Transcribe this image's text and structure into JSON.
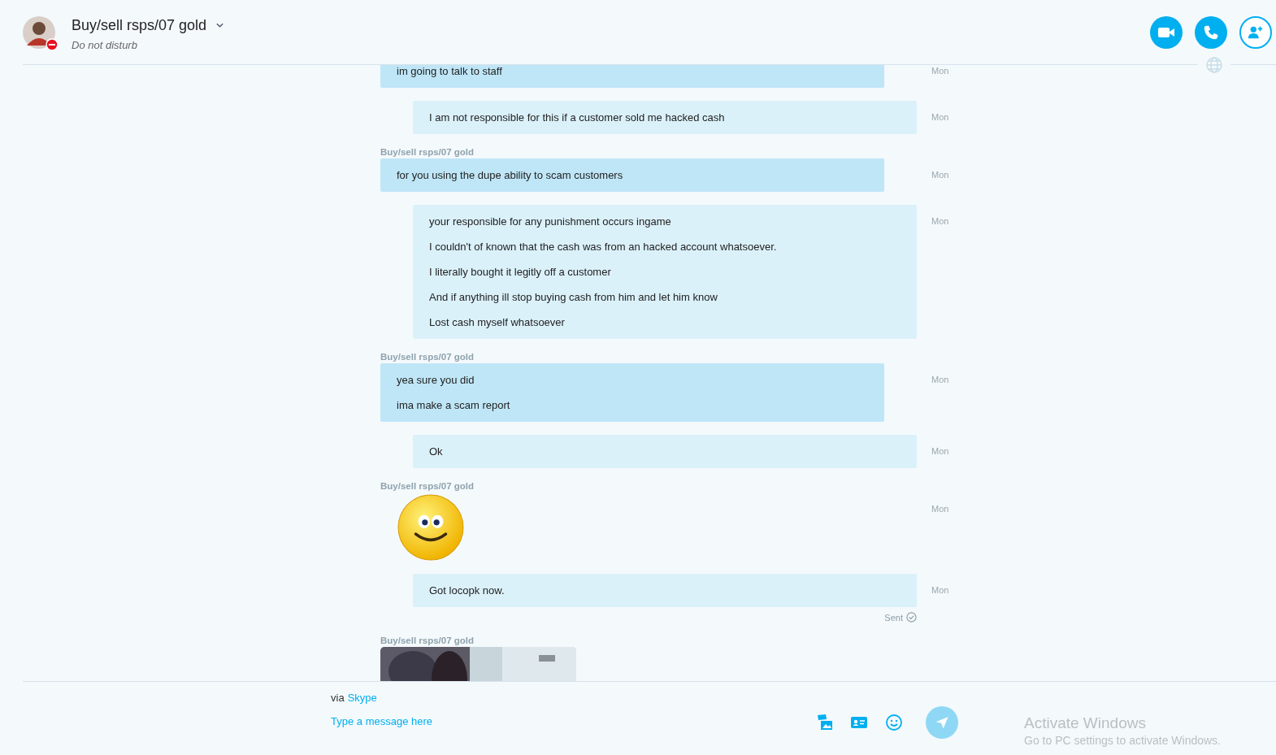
{
  "header": {
    "title": "Buy/sell rsps/07 gold",
    "status": "Do not disturb",
    "do_not_disturb": true
  },
  "messages": [
    {
      "kind": "incoming",
      "lines": [
        "im going to talk to staff"
      ],
      "time": "Mon"
    },
    {
      "kind": "outgoing",
      "lines": [
        "I am not responsible for this if a customer sold me hacked cash"
      ],
      "time": "Mon"
    },
    {
      "kind": "incoming",
      "sender": "Buy/sell rsps/07 gold",
      "lines": [
        "for you using the dupe ability to scam customers"
      ],
      "time": "Mon"
    },
    {
      "kind": "outgoing",
      "lines": [
        "your responsible for any punishment occurs ingame",
        "I couldn't of known that the cash was from an hacked account whatsoever.",
        "I literally bought it legitly off a customer",
        "And if anything ill stop buying cash from him and let him know",
        "Lost cash myself whatsoever"
      ],
      "time": "Mon"
    },
    {
      "kind": "incoming",
      "sender": "Buy/sell rsps/07 gold",
      "lines": [
        "yea sure you did",
        "ima make a scam report"
      ],
      "time": "Mon"
    },
    {
      "kind": "outgoing",
      "lines": [
        "Ok"
      ],
      "time": "Mon"
    },
    {
      "kind": "emoji",
      "sender": "Buy/sell rsps/07 gold",
      "time": "Mon"
    },
    {
      "kind": "outgoing",
      "lines": [
        "Got locopk now."
      ],
      "time": "Mon",
      "receipt": "Sent"
    },
    {
      "kind": "picture",
      "sender": "Buy/sell rsps/07 gold"
    }
  ],
  "composer": {
    "via_prefix": "via",
    "via_link": "Skype",
    "placeholder": "Type a message here"
  },
  "activation": {
    "title": "Activate Windows",
    "subtitle": "Go to PC settings to activate Windows."
  }
}
